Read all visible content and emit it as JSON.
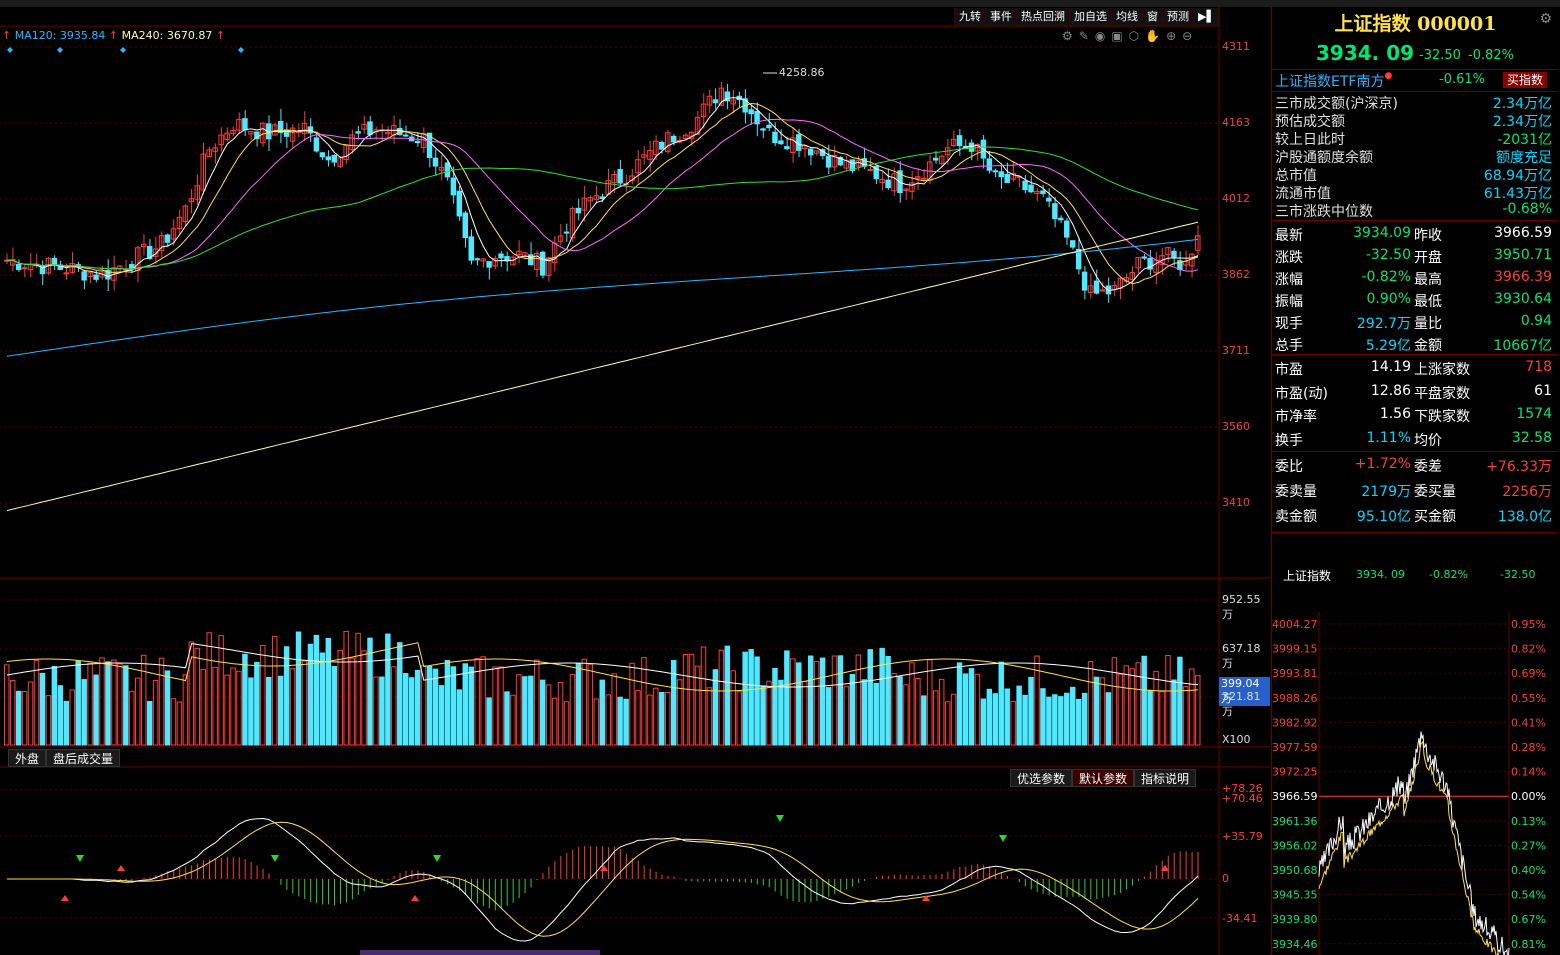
{
  "toolbar": {
    "items": [
      "九转",
      "事件",
      "热点回溯",
      "加自选",
      "均线",
      "窗",
      "预测"
    ]
  },
  "ma_legend": {
    "ma120": "MA120: 3935.84",
    "ma240": "MA240: 3670.87"
  },
  "kline": {
    "high_label": "4258.86",
    "price_axis": [
      "4311",
      "4163",
      "4012",
      "3862",
      "3711",
      "3560",
      "3410"
    ]
  },
  "volume": {
    "axis": [
      "952.55万",
      "637.18万",
      "399.04万",
      "321.81万",
      "X100"
    ]
  },
  "bottom_tabs": [
    "外盘",
    "盘后成交量"
  ],
  "indicator": {
    "buttons": [
      "优选参数",
      "默认参数",
      "指标说明"
    ],
    "axis": [
      "+78.26",
      "+70.46",
      "+35.79",
      "0",
      "-34.41"
    ]
  },
  "quote": {
    "title": "上证指数 000001",
    "price": "3934. 09",
    "change": "-32.50",
    "change_pct": "-0.82%",
    "etf_name": "上证指数ETF南方",
    "etf_pct": "-0.61%",
    "buy_btn": "买指数",
    "market_rows": [
      {
        "k": "三市成交额(沪深京)",
        "v": "2.34万亿"
      },
      {
        "k": "预估成交额",
        "v": "2.34万亿"
      },
      {
        "k": "较上日此时",
        "v": "-2031亿"
      },
      {
        "k": "沪股通额度余额",
        "v": "额度充足"
      },
      {
        "k": "总市值",
        "v": "68.94万亿"
      },
      {
        "k": "流通市值",
        "v": "61.43万亿"
      },
      {
        "k": "三市涨跌中位数",
        "v": "-0.68%"
      }
    ],
    "grid1": [
      {
        "k1": "最新",
        "v1": "3934.09",
        "k2": "昨收",
        "v2": "3966.59"
      },
      {
        "k1": "涨跌",
        "v1": "-32.50",
        "k2": "开盘",
        "v2": "3950.71"
      },
      {
        "k1": "涨幅",
        "v1": "-0.82%",
        "k2": "最高",
        "v2": "3966.39"
      },
      {
        "k1": "振幅",
        "v1": "0.90%",
        "k2": "最低",
        "v2": "3930.64"
      },
      {
        "k1": "现手",
        "v1": "292.7万",
        "k2": "量比",
        "v2": "0.94"
      },
      {
        "k1": "总手",
        "v1": "5.29亿",
        "k2": "金额",
        "v2": "10667亿"
      }
    ],
    "grid2": [
      {
        "k1": "市盈",
        "v1": "14.19",
        "k2": "上涨家数",
        "v2": "718"
      },
      {
        "k1": "市盈(动)",
        "v1": "12.86",
        "k2": "平盘家数",
        "v2": "61"
      },
      {
        "k1": "市净率",
        "v1": "1.56",
        "k2": "下跌家数",
        "v2": "1574"
      },
      {
        "k1": "换手",
        "v1": "1.11%",
        "k2": "均价",
        "v2": "32.58"
      }
    ],
    "grid3": [
      {
        "k1": "委比",
        "v1": "+1.72%",
        "k2": "委差",
        "v2": "+76.33万"
      },
      {
        "k1": "委卖量",
        "v1": "2179万",
        "k2": "委买量",
        "v2": "2256万"
      },
      {
        "k1": "卖金额",
        "v1": "95.10亿",
        "k2": "买金额",
        "v2": "138.0亿"
      }
    ],
    "mini": {
      "name": "上证指数",
      "price": "3934. 09",
      "pct": "-0.82%",
      "chg": "-32.50"
    }
  },
  "intraday": {
    "price_axis": [
      "4004.27",
      "3999.15",
      "3993.81",
      "3988.26",
      "3982.92",
      "3977.59",
      "3972.25",
      "3966.59",
      "3961.36",
      "3956.02",
      "3950.68",
      "3945.35",
      "3939.80",
      "3934.46"
    ],
    "pct_axis": [
      "0.95%",
      "0.82%",
      "0.69%",
      "0.55%",
      "0.41%",
      "0.28%",
      "0.14%",
      "0.00%",
      "0.13%",
      "0.27%",
      "0.40%",
      "0.54%",
      "0.67%",
      "0.81%"
    ]
  },
  "colors": {
    "up": "#ff3b3b",
    "down": "#4fe8ff",
    "grid": "#6a0000",
    "ma5": "#ffffff",
    "ma10": "#ffe14a",
    "ma20": "#ff66ff",
    "ma60": "#33dd33",
    "ma120": "#2ab4ff",
    "ma240": "#ffffaa"
  }
}
